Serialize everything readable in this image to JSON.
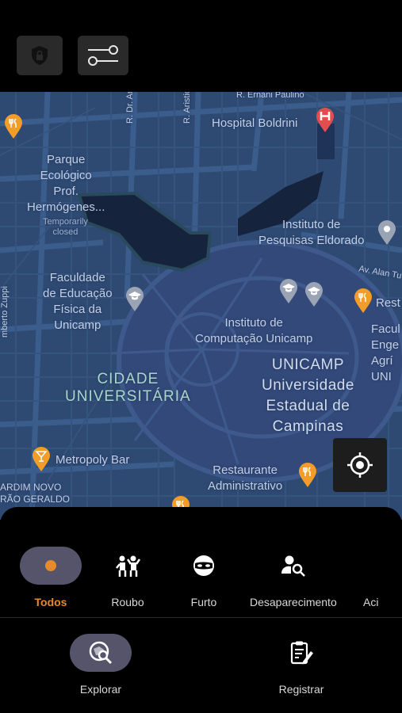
{
  "top": {
    "shield_button": "shield-icon",
    "filter_button": "sliders-icon"
  },
  "map": {
    "places": {
      "street_ernani": "R. Ernani Paulino",
      "street_antonio": "R. Dr. Antônio",
      "street_aristides": "R. Aristides L",
      "hospital": "Hospital Boldrini",
      "parque": "Parque\nEcológico\nProf.\nHermógenes...",
      "parque_status": "Temporarily\nclosed",
      "instituto_eldorado": "Instituto de\nPesquisas Eldorado",
      "av_alan": "Av. Alan Tu",
      "rest_right": "Rest",
      "faculdade_educacao": "Faculdade\nde Educação\nFísica da\nUnicamp",
      "street_zuppi": "mberto Zuppi",
      "instituto_computacao": "Instituto de\nComputação Unicamp",
      "faculdade_right": "Facul\nEnge\nAgrí\nUNI",
      "cidade_universitaria": "CIDADE\nUNIVERSITÁRIA",
      "unicamp": "UNICAMP\nUniversidade\nEstadual de\nCampinas",
      "metropoly": "Metropoly Bar",
      "jardim_novo": "ARDIM NOVO\nRÃO GERALDO",
      "restaurante": "Restaurante\nAdministrativo"
    },
    "colors": {
      "water": "#16233c",
      "campus": "#334a78",
      "pin_orange": "#f29d28",
      "pin_gray": "#9aa4b4",
      "pin_red": "#e24e4e"
    }
  },
  "categories": [
    {
      "label": "Todos",
      "icon": "dot-icon",
      "active": true
    },
    {
      "label": "Roubo",
      "icon": "robbery-icon",
      "active": false
    },
    {
      "label": "Furto",
      "icon": "mask-icon",
      "active": false
    },
    {
      "label": "Desaparecimento",
      "icon": "person-search-icon",
      "active": false
    },
    {
      "label": "Aci",
      "icon": "",
      "active": false
    }
  ],
  "bottom_nav": [
    {
      "label": "Explorar",
      "icon": "explore-search-icon",
      "active": true
    },
    {
      "label": "Registrar",
      "icon": "clipboard-edit-icon",
      "active": false
    }
  ],
  "accent": "#e78a2c"
}
